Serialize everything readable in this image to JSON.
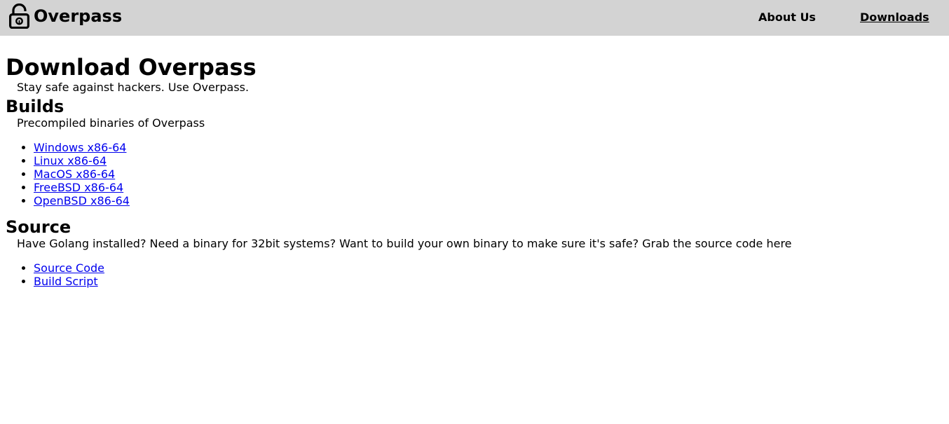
{
  "nav": {
    "brand": "Overpass",
    "about_label": "About Us",
    "downloads_label": "Downloads"
  },
  "page": {
    "title": "Download Overpass",
    "subtitle": "Stay safe against hackers. Use Overpass."
  },
  "builds": {
    "heading": "Builds",
    "description": "Precompiled binaries of Overpass",
    "links": [
      {
        "label": "Windows x86-64"
      },
      {
        "label": "Linux x86-64"
      },
      {
        "label": "MacOS x86-64"
      },
      {
        "label": "FreeBSD x86-64"
      },
      {
        "label": "OpenBSD x86-64"
      }
    ]
  },
  "source": {
    "heading": "Source",
    "description": "Have Golang installed? Need a binary for 32bit systems? Want to build your own binary to make sure it's safe? Grab the source code here",
    "links": [
      {
        "label": "Source Code"
      },
      {
        "label": "Build Script"
      }
    ]
  },
  "colors": {
    "navbar_bg": "#d3d3d3",
    "link": "#0000ee",
    "text": "#000000"
  },
  "icons": {
    "brand_icon": "unlocked-padlock-icon"
  }
}
